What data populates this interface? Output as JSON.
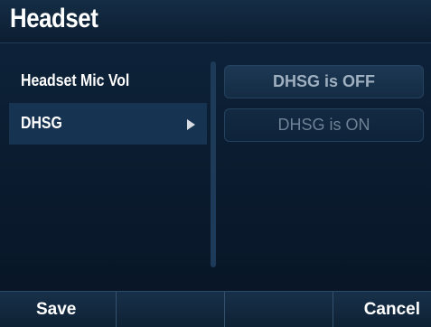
{
  "title": "Headset",
  "menu": {
    "items": [
      {
        "label": "Headset Mic Vol"
      },
      {
        "label": "DHSG",
        "selected": true,
        "icon": "triangle-right-icon"
      }
    ]
  },
  "options": [
    {
      "label": "DHSG is OFF",
      "selected": true
    },
    {
      "label": "DHSG is ON",
      "selected": false
    }
  ],
  "softkeys": [
    {
      "label": "Save"
    },
    {
      "label": ""
    },
    {
      "label": ""
    },
    {
      "label": "Cancel"
    }
  ],
  "colors": {
    "background": "#0a1a2c",
    "selected_row": "#173352",
    "softkey_bar": "#173049"
  }
}
